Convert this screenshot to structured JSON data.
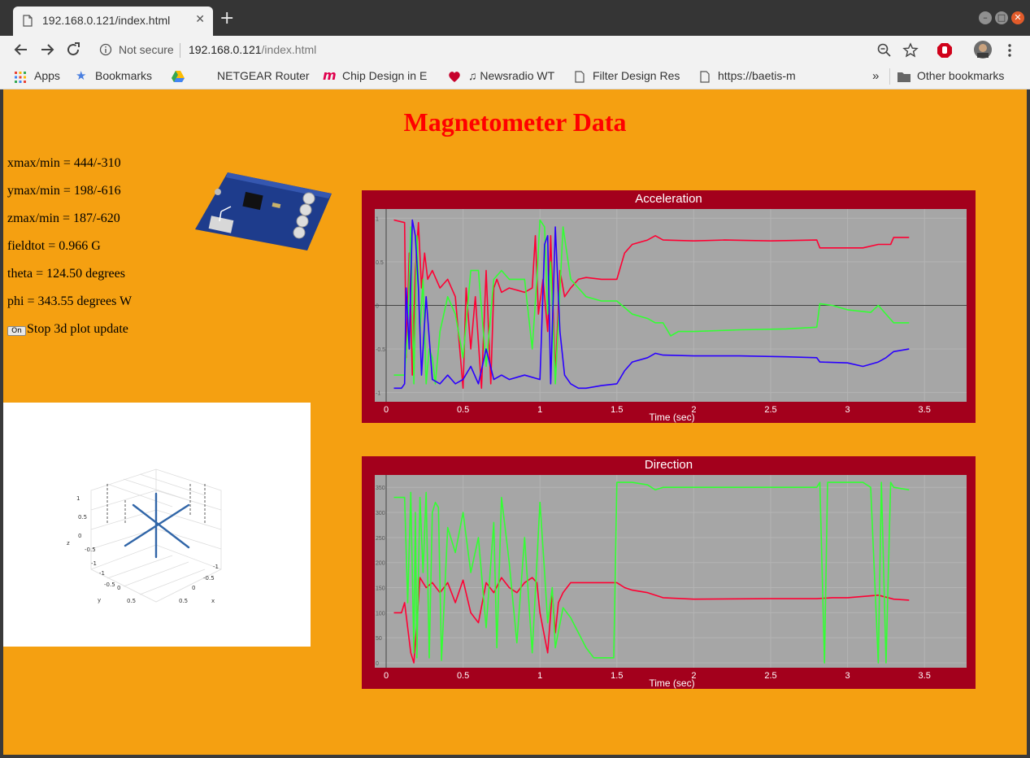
{
  "browser": {
    "tab_title": "192.168.0.121/index.html",
    "security_label": "Not secure",
    "url_host": "192.168.0.121",
    "url_path": "/index.html",
    "bookmarks": [
      {
        "label": "Apps",
        "icon": "apps-grid-icon"
      },
      {
        "label": "Bookmarks",
        "icon": "star-icon"
      },
      {
        "label": "NETGEAR Router",
        "icon": "drive-icon"
      },
      {
        "label": "Chip Design in E",
        "icon": "m-logo-icon"
      },
      {
        "label": "♫ Newsradio WT",
        "icon": "radio-icon"
      },
      {
        "label": "Filter Design Res",
        "icon": "page-icon"
      },
      {
        "label": "https://baetis-m",
        "icon": "page-icon"
      }
    ],
    "overflow_label": "»",
    "other_bookmarks": "Other bookmarks"
  },
  "page": {
    "title": "Magnetometer Data",
    "readouts": [
      "xmax/min = 444/-310",
      "ymax/min = 198/-616",
      "zmax/min = 187/-620",
      "fieldtot = 0.966 G",
      "theta = 124.50 degrees",
      "phi = 343.55 degrees W"
    ],
    "toggle_button": "On",
    "toggle_label": "Stop 3d plot update",
    "plot3d": {
      "z_ticks": [
        "1",
        "0.5",
        "0",
        "-0.5",
        "-1"
      ],
      "y_ticks": [
        "-1",
        "-0.5",
        "0",
        "0.5"
      ],
      "x_ticks": [
        "-1",
        "-0.5",
        "0",
        "0.5"
      ],
      "axis_names": [
        "z",
        "y",
        "x"
      ]
    },
    "colors": {
      "page_bg": "#f5a011",
      "chart_frame": "#a3001c",
      "plot_bg": "#a6a6a6",
      "red": "#ff0033",
      "green": "#33ff33",
      "blue": "#2a00ff"
    }
  },
  "chart_data": [
    {
      "type": "line",
      "title": "Acceleration",
      "xlabel": "Time (sec)",
      "ylabel": "",
      "xlim": [
        0,
        3.6
      ],
      "ylim": [
        -1.05,
        1.05
      ],
      "x_ticks": [
        "0",
        "0.5",
        "1",
        "1.5",
        "2",
        "2.5",
        "3",
        "3.5"
      ],
      "y_ticks": [
        "1",
        "0.5",
        "0",
        "-0.5",
        "-1"
      ],
      "series": [
        {
          "color": "#ff0033",
          "x": [
            0.05,
            0.12,
            0.13,
            0.15,
            0.17,
            0.19,
            0.21,
            0.23,
            0.25,
            0.27,
            0.3,
            0.35,
            0.4,
            0.45,
            0.5,
            0.52,
            0.55,
            0.58,
            0.62,
            0.65,
            0.68,
            0.7,
            0.72,
            0.75,
            0.8,
            0.9,
            0.95,
            0.97,
            0.99,
            1.02,
            1.05,
            1.07,
            1.1,
            1.13,
            1.16,
            1.2,
            1.25,
            1.3,
            1.4,
            1.5,
            1.55,
            1.6,
            1.7,
            1.75,
            1.8,
            2.0,
            2.2,
            2.5,
            2.8,
            2.82,
            2.9,
            3.0,
            3.1,
            3.2,
            3.28,
            3.3,
            3.4
          ],
          "y": [
            0.98,
            0.95,
            -0.6,
            0.6,
            -0.8,
            0.4,
            0.95,
            0.2,
            0.6,
            0.3,
            0.4,
            0.2,
            0.3,
            0.1,
            -0.95,
            0.2,
            -0.5,
            0.1,
            -0.95,
            0.4,
            -0.9,
            0.2,
            0.3,
            0.15,
            0.2,
            0.15,
            0.2,
            0.8,
            -0.1,
            0.3,
            -0.3,
            0.8,
            -0.8,
            0.4,
            0.1,
            0.2,
            0.3,
            0.32,
            0.3,
            0.3,
            0.6,
            0.7,
            0.75,
            0.8,
            0.75,
            0.74,
            0.75,
            0.74,
            0.75,
            0.66,
            0.66,
            0.66,
            0.66,
            0.7,
            0.7,
            0.78,
            0.78
          ]
        },
        {
          "color": "#33ff33",
          "x": [
            0.05,
            0.12,
            0.14,
            0.16,
            0.18,
            0.2,
            0.22,
            0.24,
            0.26,
            0.28,
            0.3,
            0.32,
            0.35,
            0.4,
            0.45,
            0.5,
            0.55,
            0.6,
            0.65,
            0.7,
            0.75,
            0.8,
            0.85,
            0.9,
            0.95,
            0.98,
            1.0,
            1.03,
            1.05,
            1.07,
            1.1,
            1.15,
            1.2,
            1.3,
            1.4,
            1.5,
            1.6,
            1.7,
            1.75,
            1.8,
            1.85,
            1.9,
            2.0,
            2.3,
            2.6,
            2.8,
            2.82,
            2.9,
            3.0,
            3.15,
            3.2,
            3.3,
            3.4
          ],
          "y": [
            -0.8,
            -0.8,
            -0.3,
            0.9,
            -0.9,
            0.8,
            -0.3,
            0.3,
            -0.9,
            -0.5,
            -0.6,
            -0.9,
            -0.3,
            0.1,
            -0.1,
            -0.6,
            0.4,
            0.4,
            -0.7,
            0.3,
            0.4,
            0.3,
            0.3,
            0.3,
            -0.5,
            0.3,
            0.98,
            0.9,
            -0.1,
            0.5,
            -0.9,
            0.9,
            0.3,
            0.1,
            0.05,
            0.05,
            -0.1,
            -0.15,
            -0.2,
            -0.2,
            -0.35,
            -0.3,
            -0.3,
            -0.28,
            -0.27,
            -0.25,
            0.02,
            0.0,
            -0.05,
            -0.08,
            0.0,
            -0.2,
            -0.2
          ]
        },
        {
          "color": "#2a00ff",
          "x": [
            0.05,
            0.1,
            0.12,
            0.13,
            0.15,
            0.17,
            0.19,
            0.21,
            0.23,
            0.26,
            0.3,
            0.35,
            0.4,
            0.45,
            0.5,
            0.55,
            0.6,
            0.65,
            0.7,
            0.75,
            0.8,
            0.9,
            1.0,
            1.03,
            1.05,
            1.07,
            1.1,
            1.13,
            1.16,
            1.2,
            1.25,
            1.3,
            1.4,
            1.5,
            1.55,
            1.6,
            1.7,
            1.75,
            1.8,
            2.0,
            2.3,
            2.6,
            2.8,
            2.82,
            3.0,
            3.1,
            3.2,
            3.25,
            3.3,
            3.4
          ],
          "y": [
            -0.95,
            -0.95,
            -0.9,
            0.2,
            -0.5,
            0.98,
            0.8,
            0.2,
            -0.8,
            0.1,
            -0.85,
            -0.9,
            -0.8,
            -0.9,
            -0.85,
            -0.7,
            -0.9,
            -0.5,
            -0.85,
            -0.8,
            -0.85,
            -0.8,
            -0.85,
            0.7,
            0.8,
            -0.9,
            0.9,
            -0.3,
            -0.8,
            -0.9,
            -0.95,
            -0.95,
            -0.92,
            -0.9,
            -0.75,
            -0.65,
            -0.6,
            -0.55,
            -0.57,
            -0.58,
            -0.58,
            -0.59,
            -0.6,
            -0.65,
            -0.66,
            -0.7,
            -0.65,
            -0.6,
            -0.53,
            -0.5
          ]
        }
      ]
    },
    {
      "type": "line",
      "title": "Direction",
      "xlabel": "Time (sec)",
      "ylabel": "",
      "xlim": [
        0,
        3.6
      ],
      "ylim": [
        0,
        365
      ],
      "x_ticks": [
        "0",
        "0.5",
        "1",
        "1.5",
        "2",
        "2.5",
        "3",
        "3.5"
      ],
      "y_ticks": [
        "350",
        "300",
        "250",
        "200",
        "150",
        "100",
        "50",
        "0"
      ],
      "series": [
        {
          "color": "#ff0033",
          "x": [
            0.05,
            0.1,
            0.12,
            0.14,
            0.16,
            0.18,
            0.2,
            0.22,
            0.24,
            0.26,
            0.3,
            0.35,
            0.4,
            0.45,
            0.5,
            0.55,
            0.6,
            0.65,
            0.7,
            0.75,
            0.8,
            0.85,
            0.9,
            0.95,
            0.98,
            1.0,
            1.05,
            1.08,
            1.1,
            1.12,
            1.15,
            1.2,
            1.3,
            1.4,
            1.5,
            1.55,
            1.6,
            1.7,
            1.8,
            2.0,
            2.5,
            2.8,
            2.9,
            3.0,
            3.2,
            3.3,
            3.4
          ],
          "y": [
            100,
            100,
            120,
            70,
            20,
            0,
            80,
            170,
            160,
            150,
            160,
            140,
            160,
            120,
            165,
            100,
            80,
            160,
            140,
            170,
            150,
            140,
            160,
            170,
            160,
            100,
            20,
            140,
            60,
            120,
            140,
            160,
            160,
            160,
            160,
            150,
            145,
            140,
            130,
            127,
            128,
            128,
            130,
            130,
            135,
            127,
            125
          ]
        },
        {
          "color": "#33ff33",
          "x": [
            0.05,
            0.12,
            0.14,
            0.16,
            0.18,
            0.19,
            0.2,
            0.22,
            0.24,
            0.26,
            0.28,
            0.3,
            0.32,
            0.34,
            0.36,
            0.4,
            0.45,
            0.5,
            0.55,
            0.6,
            0.65,
            0.7,
            0.72,
            0.75,
            0.8,
            0.85,
            0.9,
            0.95,
            1.0,
            1.03,
            1.05,
            1.08,
            1.1,
            1.15,
            1.2,
            1.25,
            1.3,
            1.35,
            1.4,
            1.48,
            1.5,
            1.52,
            1.6,
            1.7,
            1.75,
            1.8,
            2.0,
            2.5,
            2.8,
            2.82,
            2.85,
            2.87,
            2.9,
            3.0,
            3.1,
            3.15,
            3.2,
            3.22,
            3.25,
            3.28,
            3.3,
            3.4
          ],
          "y": [
            330,
            330,
            120,
            340,
            20,
            300,
            10,
            330,
            180,
            340,
            10,
            300,
            320,
            310,
            5,
            270,
            220,
            300,
            180,
            250,
            70,
            280,
            30,
            330,
            200,
            40,
            250,
            20,
            320,
            180,
            80,
            150,
            30,
            110,
            90,
            60,
            30,
            10,
            10,
            10,
            360,
            360,
            360,
            355,
            345,
            350,
            350,
            350,
            350,
            360,
            0,
            360,
            360,
            360,
            360,
            350,
            0,
            360,
            0,
            360,
            350,
            345
          ]
        }
      ]
    }
  ]
}
